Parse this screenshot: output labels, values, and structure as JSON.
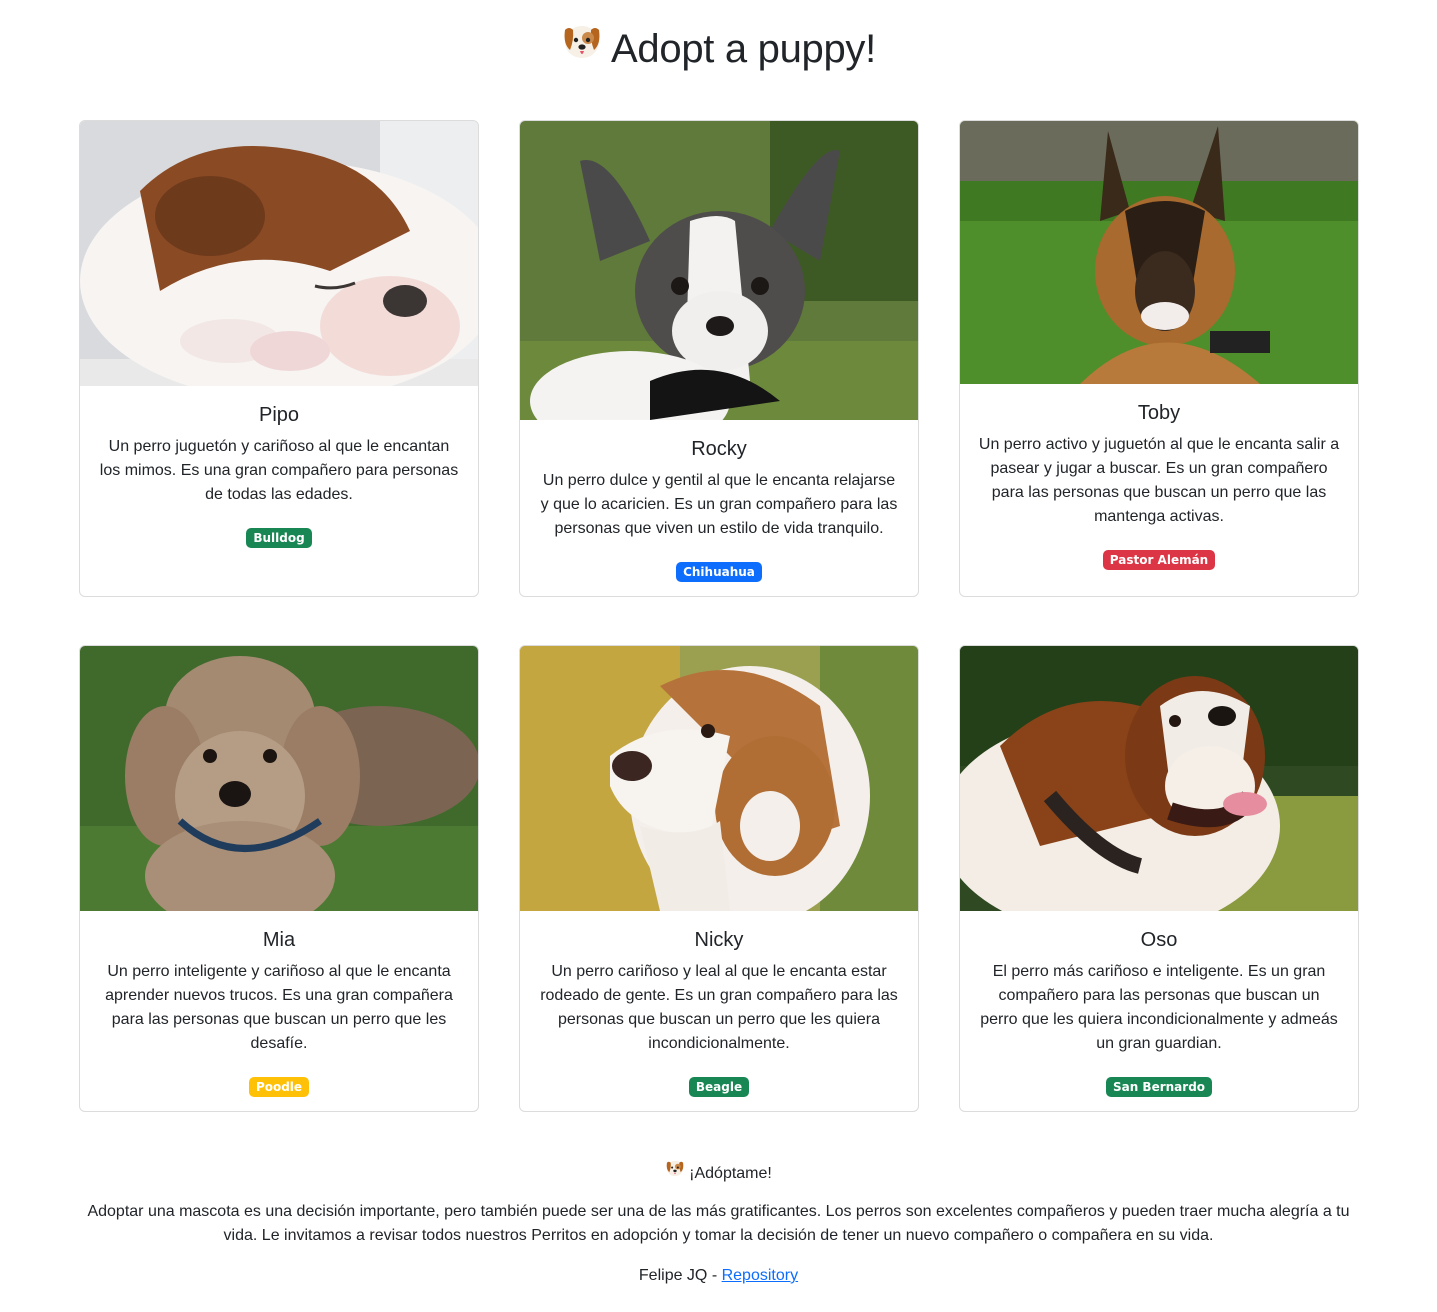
{
  "header": {
    "title": "Adopt a puppy!",
    "icon": "dog-face-icon"
  },
  "cards": [
    {
      "name": "Pipo",
      "description": "Un perro juguetón y cariñoso al que le encantan los mimos. Es una gran compañero para personas de todas las edades.",
      "breed": "Bulldog",
      "badge_color": "#198754"
    },
    {
      "name": "Rocky",
      "description": "Un perro dulce y gentil al que le encanta relajarse y que lo acaricien. Es un gran compañero para las personas que viven un estilo de vida tranquilo.",
      "breed": "Chihuahua",
      "badge_color": "#0d6efd"
    },
    {
      "name": "Toby",
      "description": "Un perro activo y juguetón al que le encanta salir a pasear y jugar a buscar. Es un gran compañero para las personas que buscan un perro que las mantenga activas.",
      "breed": "Pastor Alemán",
      "badge_color": "#dc3545"
    },
    {
      "name": "Mia",
      "description": "Un perro inteligente y cariñoso al que le encanta aprender nuevos trucos. Es una gran compañera para las personas que buscan un perro que les desafíe.",
      "breed": "Poodle",
      "badge_color": "#ffc107"
    },
    {
      "name": "Nicky",
      "description": "Un perro cariñoso y leal al que le encanta estar rodeado de gente. Es un gran compañero para las personas que buscan un perro que les quiera incondicionalmente.",
      "breed": "Beagle",
      "badge_color": "#198754"
    },
    {
      "name": "Oso",
      "description": "El perro más cariñoso e inteligente. Es un gran compañero para las personas que buscan un perro que les quiera incondicionalmente y admeás un gran guardian.",
      "breed": "San Bernardo",
      "badge_color": "#198754"
    }
  ],
  "footer": {
    "tagline": "¡Adóptame!",
    "text": "Adoptar una mascota es una decisión importante, pero también puede ser una de las más gratificantes. Los perros son excelentes compañeros y pueden traer mucha alegría a tu vida. Le invitamos a revisar todos nuestros Perritos en adopción y tomar la decisión de tener un nuevo compañero o compañera en su vida.",
    "author": "Felipe JQ - ",
    "link_label": "Repository"
  }
}
